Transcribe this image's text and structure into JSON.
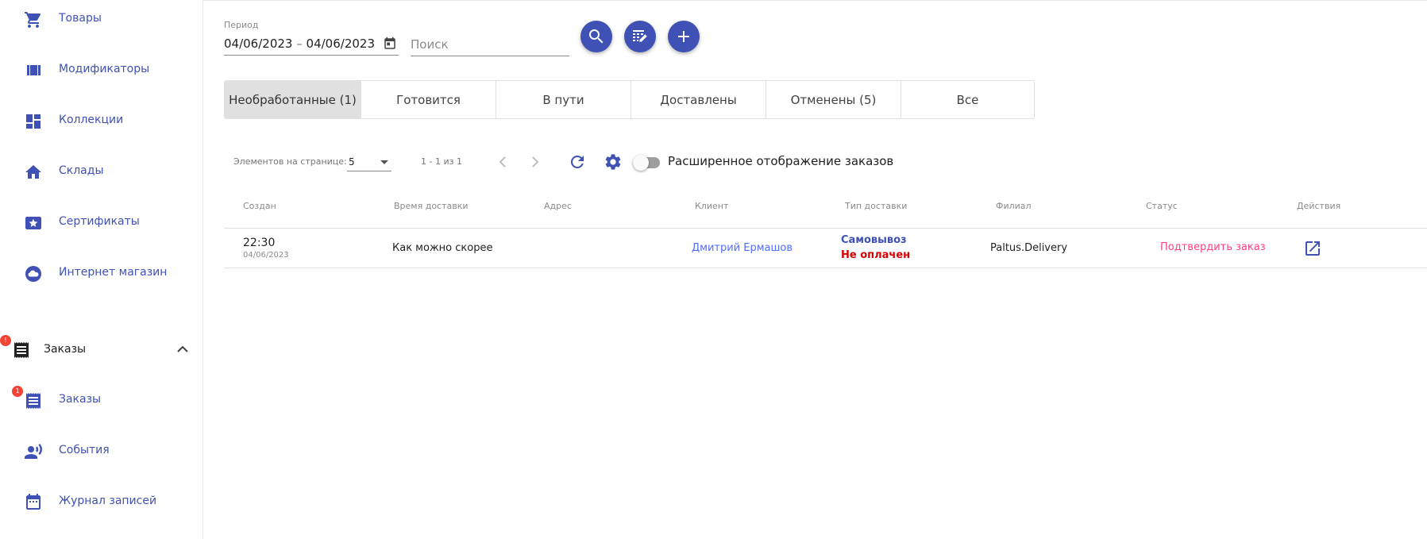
{
  "sidebar": {
    "items": [
      {
        "label": "Товары",
        "icon": "cart-icon"
      },
      {
        "label": "Модификаторы",
        "icon": "view-array-icon"
      },
      {
        "label": "Коллекции",
        "icon": "dashboard-icon"
      },
      {
        "label": "Склады",
        "icon": "home-icon"
      },
      {
        "label": "Сертификаты",
        "icon": "card-star-icon"
      },
      {
        "label": "Интернет магазин",
        "icon": "cloud-icon"
      }
    ],
    "group": {
      "label": "Заказы",
      "badge": "!",
      "icon": "receipt-icon"
    },
    "sub_items": [
      {
        "label": "Заказы",
        "badge": "1",
        "icon": "receipt-icon"
      },
      {
        "label": "События",
        "icon": "record-voice-icon"
      },
      {
        "label": "Журнал записей",
        "icon": "calendar-icon"
      }
    ]
  },
  "filters": {
    "period_label": "Период",
    "date_start": "04/06/2023",
    "date_sep": "–",
    "date_end": "04/06/2023",
    "search_placeholder": "Поиск"
  },
  "tabs": [
    {
      "label": "Необработанные (1)",
      "active": true
    },
    {
      "label": "Готовится",
      "active": false
    },
    {
      "label": "В пути",
      "active": false
    },
    {
      "label": "Доставлены",
      "active": false
    },
    {
      "label": "Отменены (5)",
      "active": false
    },
    {
      "label": "Все",
      "active": false
    }
  ],
  "paginator": {
    "per_page_label": "Элементов на странице:",
    "per_page_value": "5",
    "range": "1 - 1 из 1",
    "extended_label": "Расширенное отображение заказов",
    "extended_on": false
  },
  "table": {
    "headers": [
      "Создан",
      "Время доставки",
      "Адрес",
      "Клиент",
      "Тип доставки",
      "Филиал",
      "Статус",
      "Действия"
    ],
    "rows": [
      {
        "created_time": "22:30",
        "created_date": "04/06/2023",
        "delivery_time": "Как можно скорее",
        "address": "",
        "client": "Дмитрий Ермашов",
        "delivery_type": "Самовывоз",
        "payment_status": "Не оплачен",
        "branch": "Paltus.Delivery",
        "status_action": "Подтвердить заказ"
      }
    ]
  },
  "colors": {
    "primary": "#3f51b5",
    "link": "#536dfe",
    "danger": "#d50000",
    "accent": "#ff4081",
    "badge": "#f44336"
  }
}
